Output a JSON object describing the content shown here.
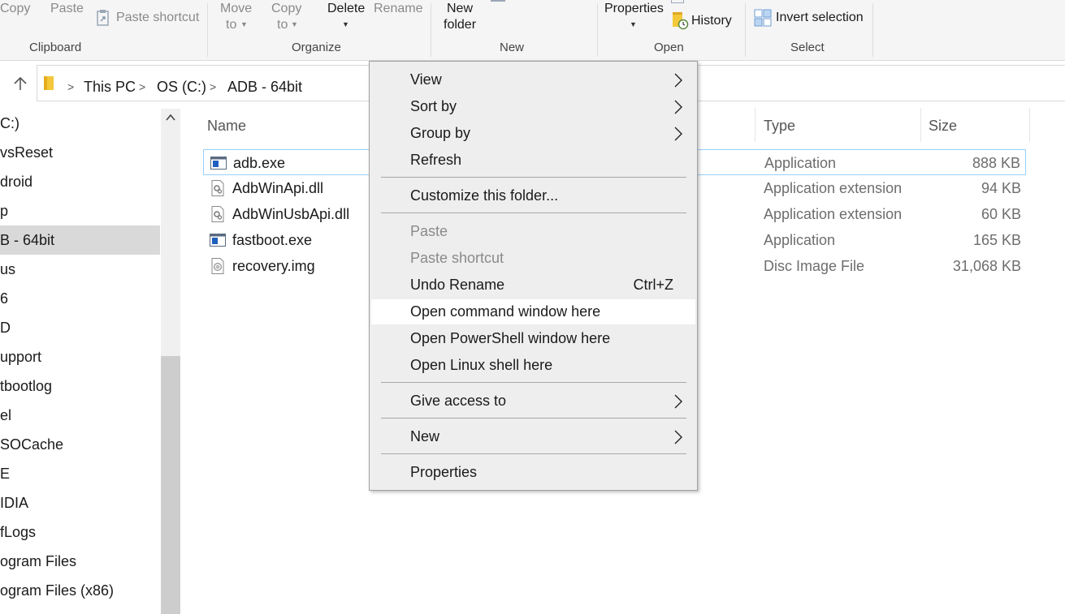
{
  "ribbon": {
    "copy": "Copy",
    "paste": "Paste",
    "paste_shortcut": "Paste shortcut",
    "move_to": [
      "Move",
      "to"
    ],
    "copy_to": [
      "Copy",
      "to"
    ],
    "delete": "Delete",
    "rename": "Rename",
    "new_folder": [
      "New",
      "folder"
    ],
    "properties": "Properties",
    "history": "History",
    "invert_selection": "Invert selection",
    "groups": {
      "clipboard": "Clipboard",
      "organize": "Organize",
      "new": "New",
      "open": "Open",
      "select": "Select"
    }
  },
  "address": {
    "crumbs": [
      "This PC",
      "OS (C:)",
      "ADB - 64bit"
    ]
  },
  "nav": {
    "items": [
      "C:)",
      "vsReset",
      "droid",
      "p",
      "B - 64bit",
      "us",
      "6",
      "D",
      "upport",
      "tbootlog",
      "el",
      "SOCache",
      "E",
      "IDIA",
      "fLogs",
      "ogram Files",
      "ogram Files (x86)"
    ],
    "selected_index": 4
  },
  "columns": {
    "name": "Name",
    "type": "Type",
    "size": "Size"
  },
  "files": [
    {
      "name": "adb.exe",
      "type": "Application",
      "size": "888 KB",
      "icon": "app"
    },
    {
      "name": "AdbWinApi.dll",
      "type": "Application extension",
      "size": "94 KB",
      "icon": "dll"
    },
    {
      "name": "AdbWinUsbApi.dll",
      "type": "Application extension",
      "size": "60 KB",
      "icon": "dll"
    },
    {
      "name": "fastboot.exe",
      "type": "Application",
      "size": "165 KB",
      "icon": "app"
    },
    {
      "name": "recovery.img",
      "type": "Disc Image File",
      "size": "31,068 KB",
      "icon": "disc"
    }
  ],
  "context_menu": {
    "view": "View",
    "sort_by": "Sort by",
    "group_by": "Group by",
    "refresh": "Refresh",
    "customize": "Customize this folder...",
    "paste": "Paste",
    "paste_shortcut": "Paste shortcut",
    "undo_rename": "Undo Rename",
    "undo_shortcut": "Ctrl+Z",
    "open_cmd": "Open command window here",
    "open_ps": "Open PowerShell window here",
    "open_linux": "Open Linux shell here",
    "give_access": "Give access to",
    "new": "New",
    "properties": "Properties"
  },
  "colors": {
    "ribbon_bg": "#f5f5f5",
    "menu_bg": "#eeeeee",
    "menu_hover": "#ffffff",
    "nav_selected": "#d9d9d9",
    "focus_border": "#99d1ff",
    "app_icon_blue": "#1f5fbf"
  }
}
